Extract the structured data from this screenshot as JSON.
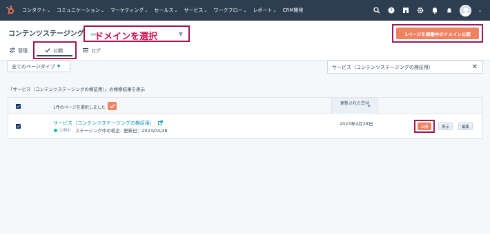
{
  "topnav": {
    "items": [
      "コンタクト",
      "コミュニケーション",
      "マーケティング",
      "セールス",
      "サービス",
      "ワークフロー",
      "レポート",
      "CRM開発"
    ],
    "icons": [
      "search-icon",
      "help-icon",
      "marketplace-icon",
      "settings-icon",
      "notifications-icon",
      "bell-icon"
    ]
  },
  "header": {
    "title": "コンテンツステージング",
    "domain_annotation": "ドメインを選択",
    "publish_domain_button": "1ページを稼働中のドメイン公開"
  },
  "tabs": [
    {
      "label": "管理",
      "icon": "sliders-icon"
    },
    {
      "label": "公開",
      "icon": "check-icon",
      "active": true
    },
    {
      "label": "ログ",
      "icon": "list-icon"
    }
  ],
  "filters": {
    "page_type": "全てのページタイプ",
    "search_value": "サービス（コンテンツステージングの検証用）"
  },
  "results": {
    "caption": "「サービス（コンテンツステージングの検証用）」の検索結果を表示",
    "selected_text": "1件のページを選択しました",
    "col_updated": "更新された日付",
    "rows": [
      {
        "title": "サービス（コンテンツステージングの検証用）",
        "status_label": "公開中",
        "status_detail": "ステージング中の校正– 更新日：2023/04/28",
        "updated": "2023年4月28日",
        "actions": {
          "publish": "公開",
          "view": "表示",
          "edit": "編集"
        }
      }
    ]
  },
  "colors": {
    "nav_bg": "#2d3e50",
    "accent": "#f08261",
    "annotation": "#a4134f",
    "link": "#0091ae",
    "live": "#00bda5"
  }
}
